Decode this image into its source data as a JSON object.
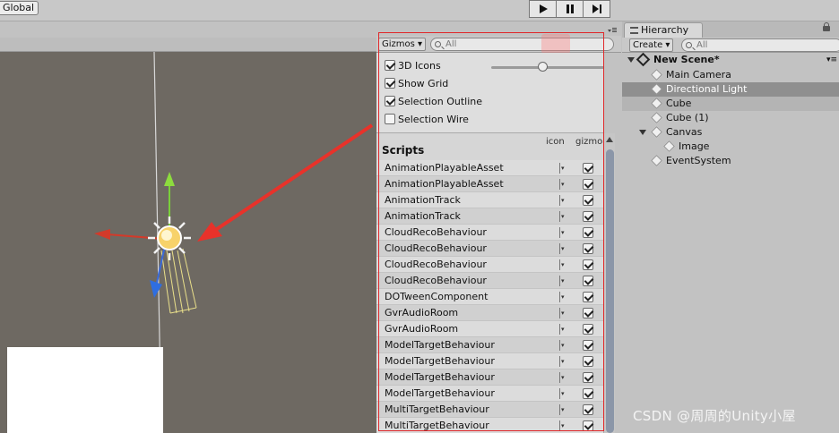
{
  "toolbar": {
    "global_label": "Global"
  },
  "gizmos": {
    "dropdown_label": "Gizmos",
    "search_placeholder": "All",
    "options": [
      {
        "label": "3D Icons",
        "checked": true
      },
      {
        "label": "Show Grid",
        "checked": true
      },
      {
        "label": "Selection Outline",
        "checked": true
      },
      {
        "label": "Selection Wire",
        "checked": false
      }
    ],
    "icon_size_slider": 0.45,
    "scripts_title": "Scripts",
    "col_icon": "icon",
    "col_gizmo": "gizmo",
    "scripts": [
      "AnimationPlayableAsset",
      "AnimationPlayableAsset",
      "AnimationTrack",
      "AnimationTrack",
      "CloudRecoBehaviour",
      "CloudRecoBehaviour",
      "CloudRecoBehaviour",
      "CloudRecoBehaviour",
      "DOTweenComponent",
      "GvrAudioRoom",
      "GvrAudioRoom",
      "ModelTargetBehaviour",
      "ModelTargetBehaviour",
      "ModelTargetBehaviour",
      "ModelTargetBehaviour",
      "MultiTargetBehaviour",
      "MultiTargetBehaviour"
    ]
  },
  "hierarchy": {
    "tab_label": "Hierarchy",
    "create_label": "Create",
    "search_placeholder": "All",
    "scene_name": "New Scene*",
    "items": [
      {
        "label": "Main Camera"
      },
      {
        "label": "Directional Light"
      },
      {
        "label": "Cube"
      },
      {
        "label": "Cube (1)"
      },
      {
        "label": "Canvas"
      },
      {
        "label": "Image"
      },
      {
        "label": "EventSystem"
      }
    ]
  },
  "watermark": "CSDN @周周的Unity小屋",
  "colors": {
    "highlight": "#e0282a",
    "scene_bg": "#6e6962",
    "selection": "#8f8f8f"
  }
}
